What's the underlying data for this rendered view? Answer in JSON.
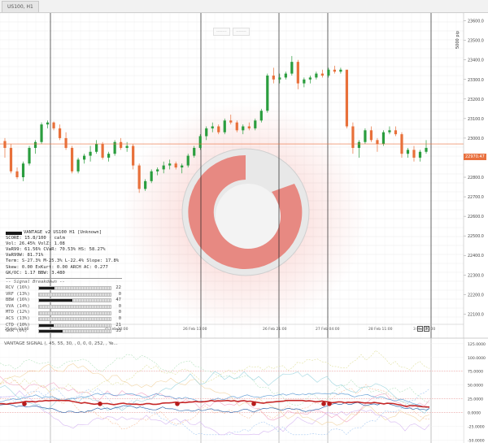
{
  "tab": {
    "title": "US100, H1"
  },
  "toolbar_strip": [
    "-------",
    "-------"
  ],
  "price_axis": {
    "ticks": [
      "23600.0",
      "23500.0",
      "23400.0",
      "23300.0",
      "23200.0",
      "23100.0",
      "23000.0",
      "22900.0",
      "22800.0",
      "22700.0",
      "22600.0",
      "22500.0",
      "22400.0",
      "22300.0",
      "22200.0",
      "22100.0"
    ],
    "current_price": "22970.47",
    "pip_label": "5000 pip"
  },
  "time_axis": {
    "ticks": [
      "25 Feb 13:00",
      "25 Feb 20:00",
      "26 Feb 13:00",
      "26 Feb 21:00",
      "27 Feb 04:00",
      "28 Feb 11:00",
      "3 Mar 20:00",
      "2 Mar 02:00"
    ]
  },
  "info_panel": {
    "header": "VANTAGE v2   US100 H1 [Unknown]",
    "lines": [
      "SCORE: 15.8/100 · calm",
      "Vol: 26.45%  VolZ: 1.08",
      "VaR99: 61.56%  CVaR: 70.53%  HS: 58.27%",
      "VaR99W: 81.71%",
      "Term: S-27.3% M-25.3% L-22.4%  Slope: 17.8%",
      "Skew: 0.00  ExKurt: 0.00  ARCH AC: 0.277",
      "GK/OC: 1.17  BBW: 3.480"
    ],
    "breakdown_title": "-- Signal Breakdown --",
    "breakdown": [
      {
        "label": "RCV (16%)",
        "value": 22,
        "level": 0.22
      },
      {
        "label": "VRF (13%)",
        "value": 0,
        "level": 0.0
      },
      {
        "label": "BBW (16%)",
        "value": 47,
        "level": 0.47
      },
      {
        "label": "VVA (14%)",
        "value": 0,
        "level": 0.0
      },
      {
        "label": "MTD (12%)",
        "value": 0,
        "level": 0.0
      },
      {
        "label": "ACS (13%)",
        "value": 0,
        "level": 0.0
      },
      {
        "label": "CTD (10%)",
        "value": 21,
        "level": 0.21
      },
      {
        "label": "GKR (6%)",
        "value": 33,
        "level": 0.33
      }
    ]
  },
  "indicator": {
    "title": "VANTAGE SIGNAL (, 45, 55, 30, , 0, 0, 0, 252, , Ye...",
    "axis": [
      "125.0000",
      "100.0000",
      "75.0000",
      "50.0000",
      "25.0000",
      "0.0000",
      "-25.0000",
      "-50.0000"
    ]
  },
  "colors": {
    "bull": "#2a9d3e",
    "bear": "#e8703a",
    "grid": "#e3e3e3",
    "vline": "#222222",
    "watermark": "#e63a2e",
    "price_line": "#e9703e"
  },
  "chart_data": {
    "type": "candlestick",
    "symbol": "US100",
    "timeframe": "H1",
    "candles": [
      [
        22985,
        23000,
        22900,
        22950
      ],
      [
        22950,
        22970,
        22820,
        22830
      ],
      [
        22830,
        22850,
        22790,
        22800
      ],
      [
        22800,
        22880,
        22780,
        22870
      ],
      [
        22870,
        22960,
        22860,
        22950
      ],
      [
        22950,
        22990,
        22920,
        22980
      ],
      [
        22980,
        23080,
        22970,
        23070
      ],
      [
        23070,
        23090,
        23050,
        23080
      ],
      [
        23080,
        23085,
        23040,
        23050
      ],
      [
        23050,
        23070,
        22990,
        23000
      ],
      [
        23000,
        23030,
        22940,
        22950
      ],
      [
        22950,
        22960,
        22820,
        22830
      ],
      [
        22830,
        22900,
        22820,
        22890
      ],
      [
        22890,
        22920,
        22870,
        22910
      ],
      [
        22910,
        22960,
        22880,
        22930
      ],
      [
        22930,
        22990,
        22920,
        22970
      ],
      [
        22970,
        22980,
        22890,
        22900
      ],
      [
        22900,
        22930,
        22880,
        22920
      ],
      [
        22920,
        22990,
        22910,
        22980
      ],
      [
        22980,
        23000,
        22940,
        22950
      ],
      [
        22950,
        22980,
        22930,
        22960
      ],
      [
        22960,
        22970,
        22840,
        22860
      ],
      [
        22860,
        22870,
        22720,
        22740
      ],
      [
        22740,
        22790,
        22730,
        22780
      ],
      [
        22780,
        22840,
        22770,
        22830
      ],
      [
        22830,
        22850,
        22810,
        22840
      ],
      [
        22840,
        22880,
        22820,
        22860
      ],
      [
        22860,
        22890,
        22840,
        22870
      ],
      [
        22870,
        22880,
        22840,
        22850
      ],
      [
        22850,
        22870,
        22820,
        22860
      ],
      [
        22860,
        22920,
        22850,
        22910
      ],
      [
        22910,
        22960,
        22900,
        22950
      ],
      [
        22950,
        23020,
        22940,
        23010
      ],
      [
        23010,
        23060,
        22990,
        23050
      ],
      [
        23050,
        23080,
        23030,
        23060
      ],
      [
        23060,
        23070,
        23020,
        23030
      ],
      [
        23030,
        23100,
        23020,
        23090
      ],
      [
        23090,
        23120,
        23070,
        23080
      ],
      [
        23080,
        23090,
        23030,
        23040
      ],
      [
        23040,
        23070,
        23020,
        23060
      ],
      [
        23060,
        23080,
        23040,
        23050
      ],
      [
        23050,
        23100,
        23040,
        23090
      ],
      [
        23090,
        23150,
        23080,
        23140
      ],
      [
        23140,
        23330,
        23130,
        23320
      ],
      [
        23320,
        23360,
        23280,
        23300
      ],
      [
        23300,
        23330,
        23280,
        23310
      ],
      [
        23310,
        23340,
        23300,
        23330
      ],
      [
        23330,
        23420,
        23320,
        23390
      ],
      [
        23390,
        23400,
        23250,
        23280
      ],
      [
        23280,
        23310,
        23260,
        23300
      ],
      [
        23300,
        23320,
        23280,
        23310
      ],
      [
        23310,
        23340,
        23300,
        23330
      ],
      [
        23330,
        23350,
        23310,
        23320
      ],
      [
        23320,
        23360,
        23310,
        23350
      ],
      [
        23350,
        23370,
        23330,
        23340
      ],
      [
        23340,
        23360,
        23330,
        23350
      ],
      [
        23350,
        23260,
        23050,
        23060
      ],
      [
        23060,
        23080,
        22920,
        22950
      ],
      [
        22950,
        22990,
        22900,
        22980
      ],
      [
        22980,
        23050,
        22970,
        23040
      ],
      [
        23040,
        23060,
        22980,
        22990
      ],
      [
        22990,
        23000,
        22930,
        22970
      ],
      [
        22970,
        23040,
        22960,
        23030
      ],
      [
        23030,
        23060,
        23020,
        23040
      ],
      [
        23040,
        23060,
        23010,
        23020
      ],
      [
        23020,
        23030,
        22900,
        22920
      ],
      [
        22920,
        22950,
        22900,
        22940
      ],
      [
        22940,
        22960,
        22880,
        22900
      ],
      [
        22900,
        22940,
        22880,
        22930
      ],
      [
        22930,
        22990,
        22920,
        22950
      ]
    ],
    "current_price": 22970.47
  }
}
